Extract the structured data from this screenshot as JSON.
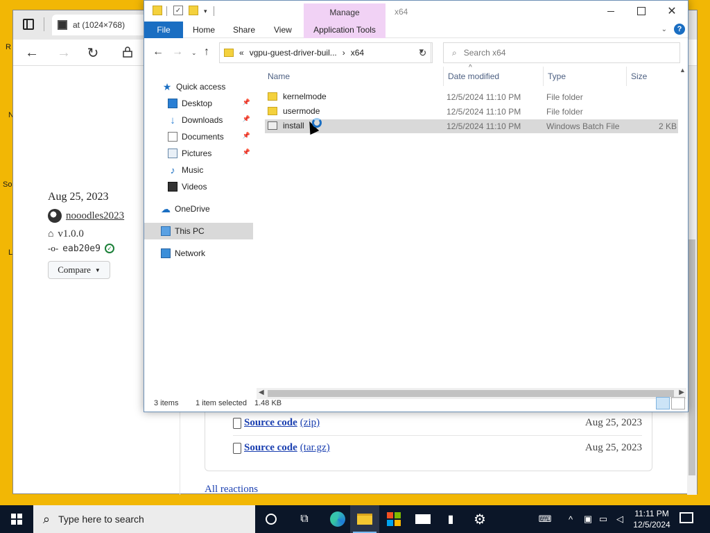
{
  "desktop": {
    "frag_r": "R",
    "frag_n": "N",
    "frag_so": "So",
    "frag_l": "L"
  },
  "browser": {
    "tab_title": "at (1024×768)",
    "release": {
      "date": "Aug 25, 2023",
      "author": "nooodles2023",
      "tag": "v1.0.0",
      "commit": "eab20e9",
      "compare_label": "Compare"
    },
    "assets": [
      {
        "name": "Source code",
        "ext": "(zip)",
        "date": "Aug 25, 2023"
      },
      {
        "name": "Source code",
        "ext": "(tar.gz)",
        "date": "Aug 25, 2023"
      }
    ],
    "reactions_label": "All reactions"
  },
  "explorer": {
    "window_title": "x64",
    "manage_label": "Manage",
    "ribbon_tabs": {
      "file": "File",
      "home": "Home",
      "share": "Share",
      "view": "View",
      "app_tools": "Application Tools"
    },
    "address": {
      "chevron": "«",
      "segment1": "vgpu-guest-driver-buil...",
      "separator": "›",
      "segment2": "x64"
    },
    "search_placeholder": "Search x64",
    "nav": {
      "quick_access": "Quick access",
      "desktop": "Desktop",
      "downloads": "Downloads",
      "documents": "Documents",
      "pictures": "Pictures",
      "music": "Music",
      "videos": "Videos",
      "onedrive": "OneDrive",
      "this_pc": "This PC",
      "network": "Network"
    },
    "columns": {
      "name": "Name",
      "date": "Date modified",
      "type": "Type",
      "size": "Size"
    },
    "files": [
      {
        "name": "kernelmode",
        "date": "12/5/2024 11:10 PM",
        "type": "File folder",
        "size": ""
      },
      {
        "name": "usermode",
        "date": "12/5/2024 11:10 PM",
        "type": "File folder",
        "size": ""
      },
      {
        "name": "install",
        "date": "12/5/2024 11:10 PM",
        "type": "Windows Batch File",
        "size": "2 KB"
      }
    ],
    "status": {
      "items": "3 items",
      "selected": "1 item selected",
      "size": "1.48 KB"
    }
  },
  "taskbar": {
    "search_placeholder": "Type here to search",
    "time": "11:11 PM",
    "date": "12/5/2024"
  }
}
